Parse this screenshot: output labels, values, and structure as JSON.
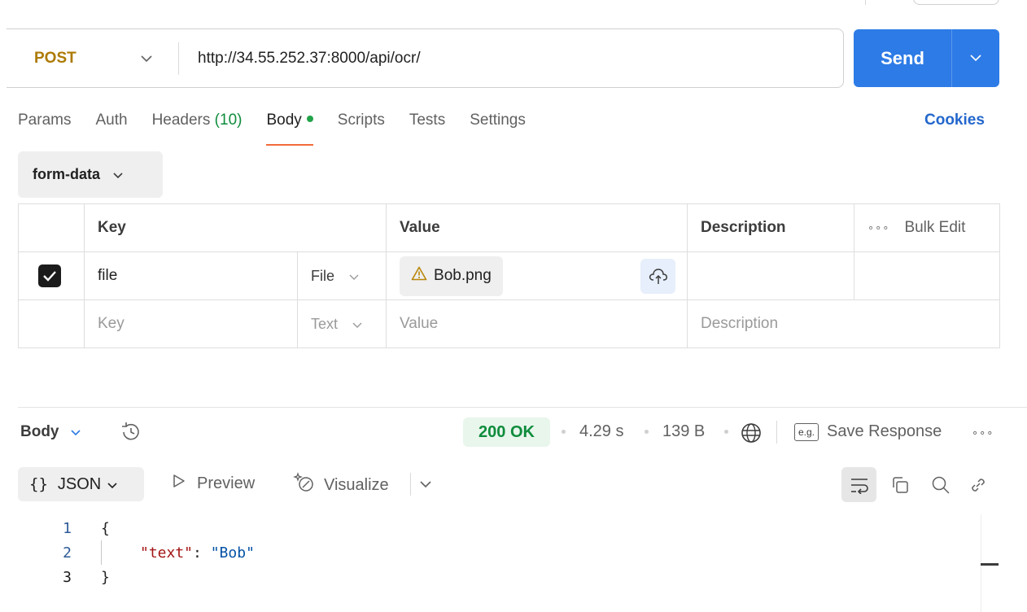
{
  "request": {
    "method": "POST",
    "url": "http://34.55.252.37:8000/api/ocr/",
    "send_label": "Send"
  },
  "tabs": [
    {
      "label": "Params"
    },
    {
      "label": "Auth"
    },
    {
      "label": "Headers",
      "count": "(10)"
    },
    {
      "label": "Body",
      "active": true,
      "indicator": "green-dot"
    },
    {
      "label": "Scripts"
    },
    {
      "label": "Tests"
    },
    {
      "label": "Settings"
    }
  ],
  "cookies_label": "Cookies",
  "body_type": "form-data",
  "table": {
    "headers": {
      "key": "Key",
      "value": "Value",
      "description": "Description",
      "bulk_edit": "Bulk Edit"
    },
    "rows": [
      {
        "checked": true,
        "key": "file",
        "type": "File",
        "value": "Bob.png",
        "value_warning": true
      },
      {
        "key_placeholder": "Key",
        "type": "Text",
        "value_placeholder": "Value",
        "description_placeholder": "Description"
      }
    ]
  },
  "response": {
    "body_label": "Body",
    "status": "200 OK",
    "time": "4.29 s",
    "size": "139 B",
    "eg_label": "e.g.",
    "save_label": "Save Response",
    "format": "JSON",
    "preview_label": "Preview",
    "visualize_label": "Visualize",
    "code_lines": [
      {
        "num": "1",
        "text": "{"
      },
      {
        "num": "2",
        "key": "\"text\"",
        "sep": ": ",
        "value": "\"Bob\""
      },
      {
        "num": "3",
        "text": "}"
      }
    ]
  },
  "colors": {
    "method": "#ad7a03",
    "send": "#2d7be6",
    "active_tab_underline": "#f26b3a",
    "status_ok": "#0f8c3c",
    "cookies": "#2367cc"
  }
}
